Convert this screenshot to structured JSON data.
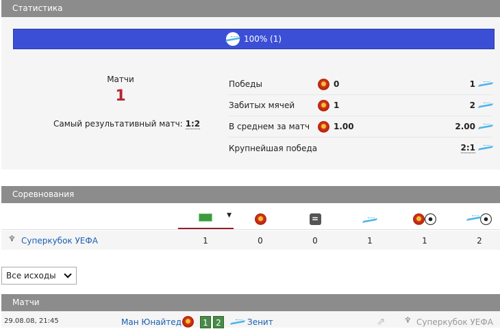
{
  "stats": {
    "title": "Статистика",
    "bar_label": "100% (1)",
    "bar_fraction": 1.0,
    "bar_color": "#3b4fd6",
    "matches_label": "Матчи",
    "matches_count": "1",
    "top_match_label": "Самый результативный матч:",
    "top_match_score": "1:2",
    "rows": [
      {
        "label": "Победы",
        "left": "0",
        "right": "1"
      },
      {
        "label": "Забитых мячей",
        "left": "1",
        "right": "2"
      },
      {
        "label": "В среднем за матч",
        "left": "1.00",
        "right": "2.00"
      },
      {
        "label": "Крупнейшая победа",
        "left": "",
        "right": "2:1"
      }
    ]
  },
  "competitions": {
    "title": "Соревнования",
    "columns": [
      "pitch-icon",
      "man-utd-icon",
      "draw-icon",
      "zenit-icon",
      "man-utd-goals-icon",
      "zenit-goals-icon"
    ],
    "rows": [
      {
        "name": "Суперкубок УЕФА",
        "values": [
          "1",
          "0",
          "0",
          "1",
          "1",
          "2"
        ]
      }
    ]
  },
  "filter": {
    "selected": "Все исходы"
  },
  "matches": {
    "title": "Матчи",
    "rows": [
      {
        "date": "29.08.08, 21:45",
        "home": "Ман Юнайтед",
        "home_score": "1",
        "away_score": "2",
        "away": "Зенит",
        "competition": "Суперкубок УЕФА"
      }
    ]
  }
}
